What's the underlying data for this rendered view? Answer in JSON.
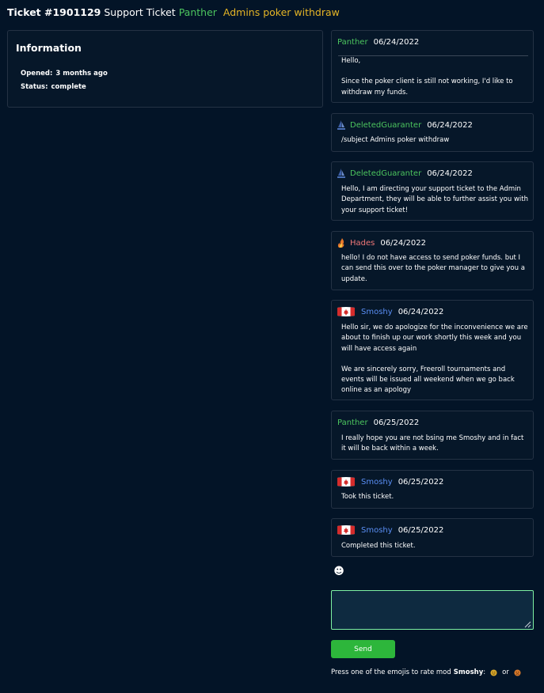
{
  "header": {
    "ticket_number": "Ticket #1901129",
    "ticket_kind": "Support Ticket",
    "user": "Panther",
    "subject": "Admins poker withdraw"
  },
  "info": {
    "heading": "Information",
    "opened_label": "Opened:",
    "opened_value": "3 months ago",
    "status_label": "Status:",
    "status_value": "complete"
  },
  "messages": [
    {
      "author": "Panther",
      "date": "06/24/2022",
      "icon": "none",
      "paragraphs": [
        "Hello,",
        "Since the poker client is still not working, I'd like to withdraw my funds."
      ]
    },
    {
      "author": "DeletedGuaranter",
      "date": "06/24/2022",
      "icon": "ship-icon",
      "paragraphs": [
        "/subject Admins poker withdraw"
      ]
    },
    {
      "author": "DeletedGuaranter",
      "date": "06/24/2022",
      "icon": "ship-icon",
      "paragraphs": [
        "Hello, I am directing your support ticket to the Admin Department, they will be able to further assist you with your support ticket!"
      ]
    },
    {
      "author": "Hades",
      "date": "06/24/2022",
      "icon": "flame-icon",
      "paragraphs": [
        "hello! I do not have access to send poker funds. but I can send this over to the poker manager to give you a update."
      ]
    },
    {
      "author": "Smoshy",
      "date": "06/24/2022",
      "icon": "canada-flag-icon",
      "paragraphs": [
        "Hello sir, we do apologize for the inconvenience we are about to finish up our work shortly this week and you will have access again",
        "We are sincerely sorry, Freeroll tournaments and events will be issued all weekend when we go back online as an apology"
      ]
    },
    {
      "author": "Panther",
      "date": "06/25/2022",
      "icon": "none",
      "paragraphs": [
        "I really hope you are not bsing me Smoshy and in fact it will be back within a week."
      ]
    },
    {
      "author": "Smoshy",
      "date": "06/25/2022",
      "icon": "canada-flag-icon",
      "paragraphs": [
        "Took this ticket."
      ]
    },
    {
      "author": "Smoshy",
      "date": "06/25/2022",
      "icon": "canada-flag-icon",
      "paragraphs": [
        "Completed this ticket."
      ]
    }
  ],
  "reply": {
    "emoji_button": "☻",
    "textarea_value": "",
    "send_label": "Send"
  },
  "rating": {
    "prompt": "Press one of the emojis to rate mod",
    "mod_name": "Smoshy",
    "colon": ":",
    "or": "or"
  },
  "colors": {
    "background": "#031427",
    "panther": "#4cc55e",
    "subject": "#e5b526",
    "hades": "#f07777",
    "smoshy": "#5a8ef4",
    "send": "#2db63b"
  }
}
